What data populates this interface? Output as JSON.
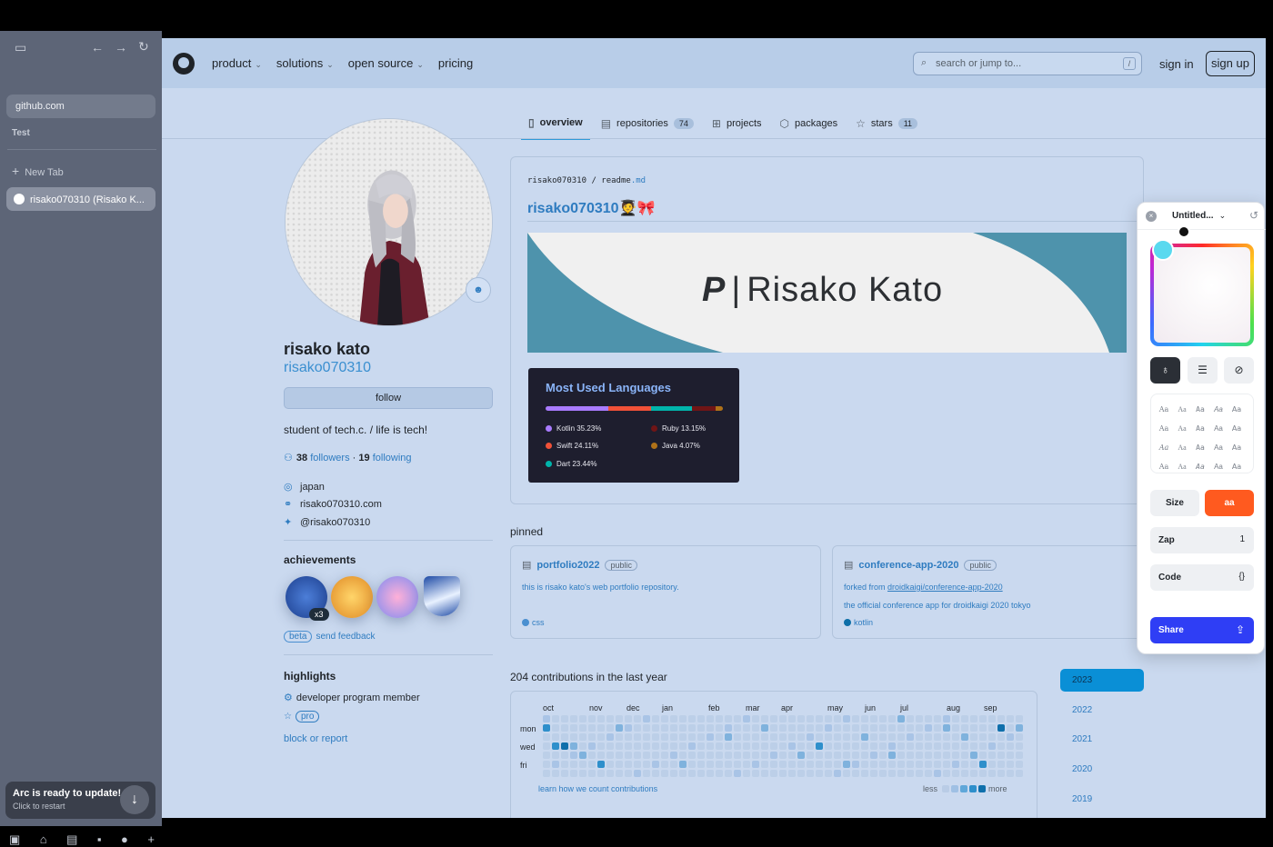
{
  "arc": {
    "address": "github.com",
    "space_label": "Test",
    "new_tab": "New Tab",
    "active_tab": "risako070310 (Risako K...",
    "update_title": "Arc is ready to update!",
    "update_sub": "Click to restart"
  },
  "header": {
    "nav": [
      "product",
      "solutions",
      "open source",
      "pricing"
    ],
    "search_placeholder": "search or jump to...",
    "search_key": "/",
    "sign_in": "sign in",
    "sign_up": "sign up"
  },
  "tabs": [
    {
      "label": "overview",
      "count": ""
    },
    {
      "label": "repositories",
      "count": "74"
    },
    {
      "label": "projects",
      "count": ""
    },
    {
      "label": "packages",
      "count": ""
    },
    {
      "label": "stars",
      "count": "11"
    }
  ],
  "profile": {
    "name": "risako kato",
    "login": "risako070310",
    "follow": "follow",
    "bio": "student of tech.c. / life is tech!",
    "followers_count": "38",
    "followers_label": "followers",
    "dot": "·",
    "following_count": "19",
    "following_label": "following",
    "location": "japan",
    "website": "risako070310.com",
    "twitter": "@risako070310"
  },
  "achievements": {
    "title": "achievements",
    "multiplier": "x3",
    "beta": "beta",
    "feedback": "send feedback"
  },
  "highlights": {
    "title": "highlights",
    "item1": "developer program member",
    "pro": "pro",
    "block": "block or report"
  },
  "readme": {
    "path_user": "risako070310",
    "path_sep": "/",
    "path_file": "readme",
    "path_ext": ".md",
    "title": "risako070310🧑‍🎓🎀",
    "banner_name": "Risako Kato",
    "banner_logo": "P",
    "langs_title": "Most Used Languages",
    "languages": [
      {
        "name": "Kotlin 35.23%",
        "color": "#a97bff",
        "pct": 35.23
      },
      {
        "name": "Swift 24.11%",
        "color": "#f05138",
        "pct": 24.11
      },
      {
        "name": "Dart 23.44%",
        "color": "#00b4ab",
        "pct": 23.44
      },
      {
        "name": "Ruby 13.15%",
        "color": "#701516",
        "pct": 13.15
      },
      {
        "name": "Java 4.07%",
        "color": "#b07219",
        "pct": 4.07
      }
    ]
  },
  "pinned": {
    "title": "pinned",
    "repos": [
      {
        "name": "portfolio2022",
        "vis": "public",
        "desc": "this is risako kato's web portfolio repository.",
        "desc2": "",
        "lang": "css",
        "lang_color": "#563d7c"
      },
      {
        "name": "conference-app-2020",
        "vis": "public",
        "forked_prefix": "forked from",
        "forked_link": "droidkaigi/conference-app-2020",
        "desc2": "the official conference app for droidkaigi 2020 tokyo",
        "lang": "kotlin",
        "lang_color": "#a97bff"
      }
    ]
  },
  "contributions": {
    "title": "204 contributions in the last year",
    "months": [
      "oct",
      "nov",
      "dec",
      "jan",
      "feb",
      "mar",
      "apr",
      "may",
      "jun",
      "jul",
      "aug",
      "sep"
    ],
    "days": [
      "mon",
      "wed",
      "fri"
    ],
    "learn": "learn how we count contributions",
    "less": "less",
    "more": "more",
    "years": [
      "2023",
      "2022",
      "2021",
      "2020",
      "2019"
    ],
    "selected_year": "2023"
  },
  "panel": {
    "title": "Untitled...",
    "size": "Size",
    "aa": "aa",
    "zap": "Zap",
    "zap_value": "1",
    "code": "Code",
    "code_value": "{}",
    "share": "Share",
    "font_samples": [
      "Aa",
      "Aa",
      "Aa",
      "Aa",
      "Aa",
      "Aa",
      "Aa",
      "Aa",
      "Aa",
      "Aa",
      "Aa",
      "Aa",
      "Aa",
      "Aa",
      "Aa",
      "Aa",
      "Aa",
      "Aa",
      "Aa",
      "Aa"
    ]
  },
  "colors": {
    "accent": "#2f7cc0",
    "page_bg": "#cad9ef",
    "header_bg": "#b8cde8"
  }
}
